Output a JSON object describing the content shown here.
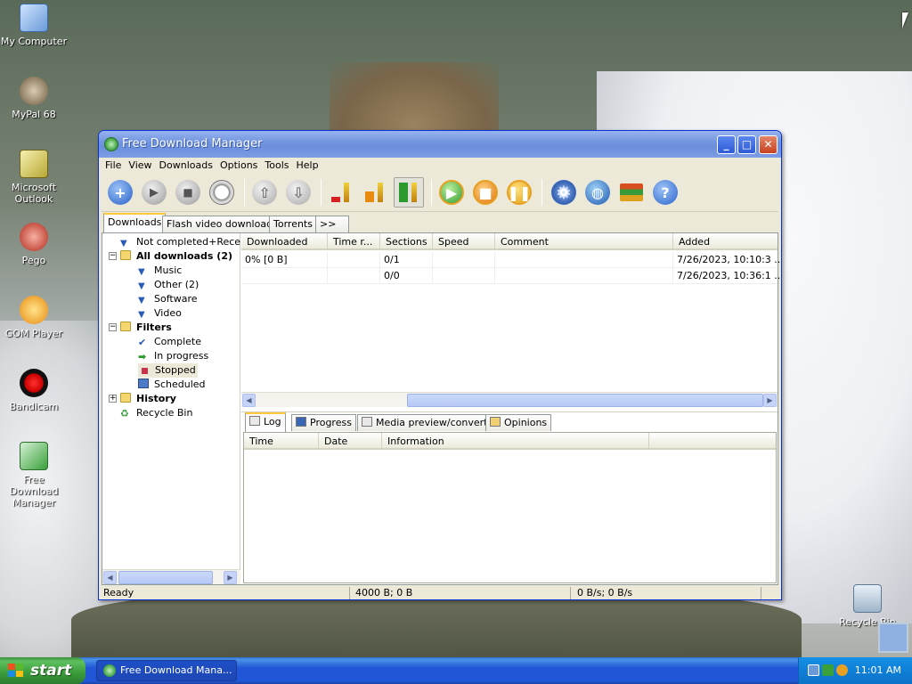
{
  "desktop": {
    "icons": [
      {
        "label": "My Computer"
      },
      {
        "label": "MyPal 68"
      },
      {
        "label": "Microsoft Outlook"
      },
      {
        "label": "Pego"
      },
      {
        "label": "GOM Player"
      },
      {
        "label": "Bandicam"
      },
      {
        "label": "Free Download Manager"
      },
      {
        "label": "Recycle Bin"
      }
    ]
  },
  "window": {
    "title": "Free Download Manager",
    "controls": {
      "minimize": "_",
      "maximize": "□",
      "close": "✕"
    }
  },
  "menu": [
    "File",
    "View",
    "Downloads",
    "Options",
    "Tools",
    "Help"
  ],
  "toolbar": [
    {
      "name": "add",
      "icon": "plus-icon"
    },
    {
      "name": "start",
      "icon": "play-icon"
    },
    {
      "name": "stop",
      "icon": "stop-icon"
    },
    {
      "name": "schedule",
      "icon": "alarm-clock-icon"
    },
    {
      "name": "move-up",
      "icon": "arrow-up-icon"
    },
    {
      "name": "move-down",
      "icon": "arrow-down-icon"
    },
    {
      "name": "traffic-low",
      "icon": "traffic-low-icon"
    },
    {
      "name": "traffic-medium",
      "icon": "traffic-medium-icon"
    },
    {
      "name": "traffic-high",
      "icon": "traffic-high-icon"
    },
    {
      "name": "start-all",
      "icon": "start-all-icon"
    },
    {
      "name": "stop-all",
      "icon": "stop-all-icon"
    },
    {
      "name": "pause-all",
      "icon": "pause-all-icon"
    },
    {
      "name": "settings",
      "icon": "gear-icon"
    },
    {
      "name": "site-explorer",
      "icon": "globe-icon"
    },
    {
      "name": "books",
      "icon": "books-icon"
    },
    {
      "name": "help",
      "icon": "help-icon"
    }
  ],
  "tabs": [
    "Downloads",
    "Flash video downloads",
    "Torrents",
    ">>"
  ],
  "tree": {
    "not_completed": "Not completed+Recen",
    "all_downloads": "All downloads (2)",
    "music": "Music",
    "other": "Other (2)",
    "software": "Software",
    "video": "Video",
    "filters": "Filters",
    "complete": "Complete",
    "in_progress": "In progress",
    "stopped": "Stopped",
    "scheduled": "Scheduled",
    "history": "History",
    "recycle_bin": "Recycle Bin"
  },
  "downloads_table": {
    "columns": [
      "Downloaded",
      "Time r...",
      "Sections",
      "Speed",
      "Comment",
      "Added"
    ],
    "rows": [
      {
        "downloaded": "0% [0 B]",
        "time_remaining": "",
        "sections": "0/1",
        "speed": "",
        "comment": "",
        "added": "7/26/2023, 10:10:3 ..."
      },
      {
        "downloaded": "",
        "time_remaining": "",
        "sections": "0/0",
        "speed": "",
        "comment": "",
        "added": "7/26/2023, 10:36:1 ..."
      }
    ]
  },
  "bottom_tabs": [
    "Log",
    "Progress",
    "Media preview/convert",
    "Opinions"
  ],
  "log_columns": [
    "Time",
    "Date",
    "Information"
  ],
  "status": {
    "ready": "Ready",
    "sizes": "4000 B; 0 B",
    "speeds": "0 B/s; 0 B/s"
  },
  "taskbar": {
    "start_label": "start",
    "task_label": "Free Download Mana...",
    "clock": "11:01 AM"
  }
}
